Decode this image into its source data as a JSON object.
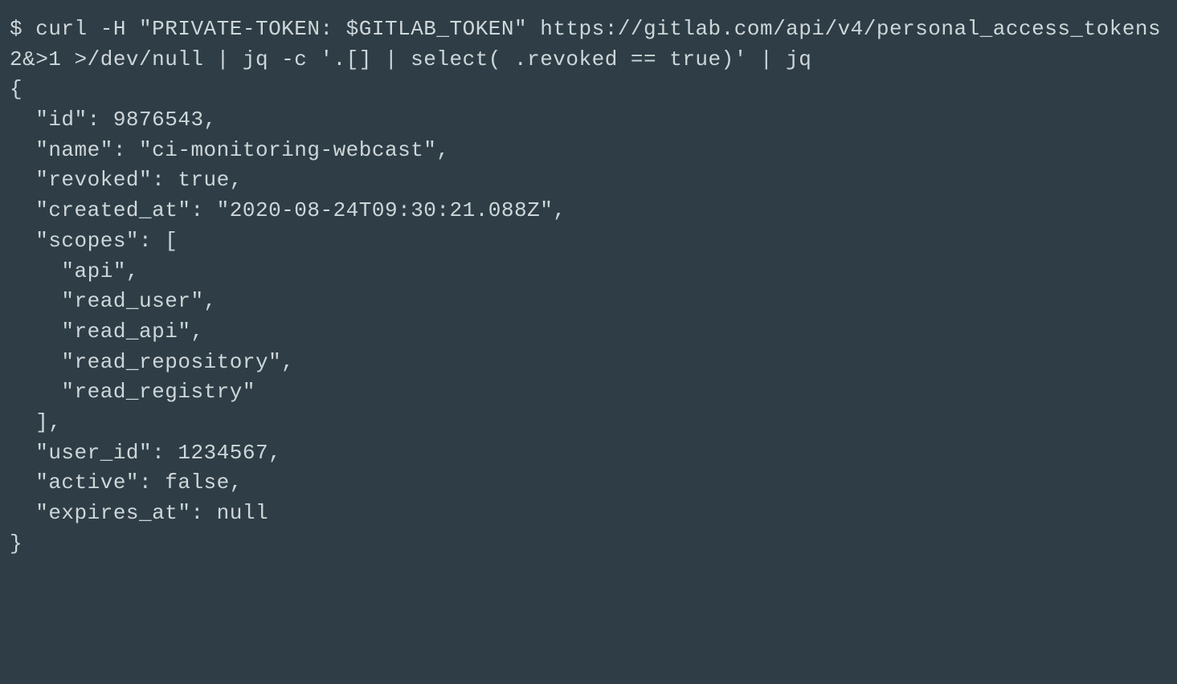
{
  "terminal": {
    "prompt": "$ ",
    "command": "curl -H \"PRIVATE-TOKEN: $GITLAB_TOKEN\" https://gitlab.com/api/v4/personal_access_tokens 2&>1 >/dev/null | jq -c '.[] | select( .revoked == true)' | jq",
    "output_lines": [
      "{",
      "  \"id\": 9876543,",
      "  \"name\": \"ci-monitoring-webcast\",",
      "  \"revoked\": true,",
      "  \"created_at\": \"2020-08-24T09:30:21.088Z\",",
      "  \"scopes\": [",
      "    \"api\",",
      "    \"read_user\",",
      "    \"read_api\",",
      "    \"read_repository\",",
      "    \"read_registry\"",
      "  ],",
      "  \"user_id\": 1234567,",
      "  \"active\": false,",
      "  \"expires_at\": null",
      "}"
    ],
    "json_response": {
      "id": 9876543,
      "name": "ci-monitoring-webcast",
      "revoked": true,
      "created_at": "2020-08-24T09:30:21.088Z",
      "scopes": [
        "api",
        "read_user",
        "read_api",
        "read_repository",
        "read_registry"
      ],
      "user_id": 1234567,
      "active": false,
      "expires_at": null
    }
  }
}
